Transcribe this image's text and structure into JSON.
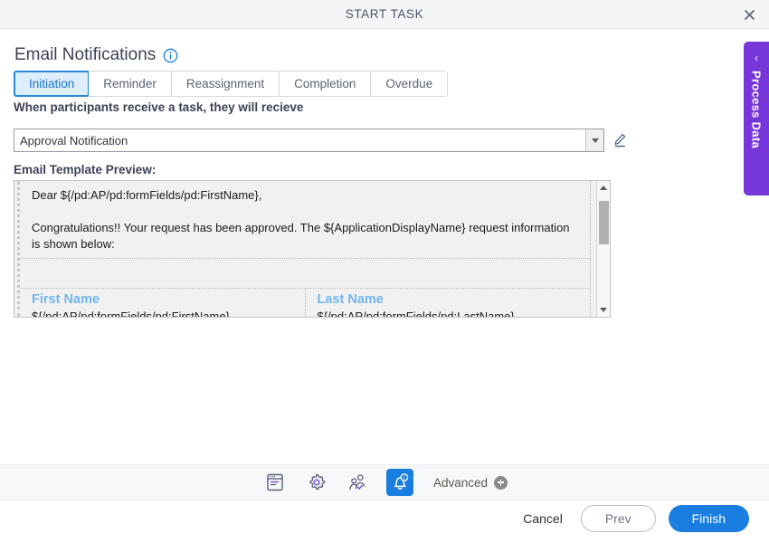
{
  "window": {
    "title": "START TASK",
    "close_icon": "close-icon"
  },
  "page": {
    "heading": "Email Notifications",
    "info_icon": "info-icon"
  },
  "tabs": [
    {
      "label": "Initiation",
      "active": true
    },
    {
      "label": "Reminder",
      "active": false
    },
    {
      "label": "Reassignment",
      "active": false
    },
    {
      "label": "Completion",
      "active": false
    },
    {
      "label": "Overdue",
      "active": false
    }
  ],
  "notification_field": {
    "label": "When participants receive a task, they will recieve",
    "selected_value": "Approval Notification",
    "dropdown_icon": "chevron-down-icon",
    "edit_icon": "pencil-icon"
  },
  "preview": {
    "label": "Email Template Preview:",
    "greeting": "Dear ${/pd:AP/pd:formFields/pd:FirstName},",
    "body": "Congratulations!! Your request has been approved. The ${ApplicationDisplayName} request information is shown below:",
    "fields": [
      {
        "name": "First Name",
        "value": "${/pd:AP/pd:formFields/pd:FirstName}"
      },
      {
        "name": "Last Name",
        "value": "${/pd:AP/pd:formFields/pd:LastName}"
      }
    ],
    "scroll_up_icon": "scroll-up-arrow-icon",
    "scroll_down_icon": "scroll-down-arrow-icon"
  },
  "process_data_panel": {
    "label": "Process Data",
    "chevron": "‹",
    "color": "#7736d9"
  },
  "toolbar": {
    "icons": [
      {
        "name": "form-icon",
        "active": false
      },
      {
        "name": "gear-icon",
        "active": false
      },
      {
        "name": "participant-check-icon",
        "active": false
      },
      {
        "name": "bell-notification-icon",
        "active": true,
        "badge": "1"
      }
    ],
    "advanced_label": "Advanced",
    "advanced_plus_icon": "plus-circle-icon"
  },
  "footer": {
    "cancel": "Cancel",
    "prev": "Prev",
    "finish": "Finish"
  },
  "colors": {
    "accent_blue": "#1a7ee0",
    "tab_active_bg": "#ddeeff",
    "tab_active_text": "#1a73c7",
    "purple": "#7736d9",
    "field_name_blue": "#72b6ec"
  }
}
